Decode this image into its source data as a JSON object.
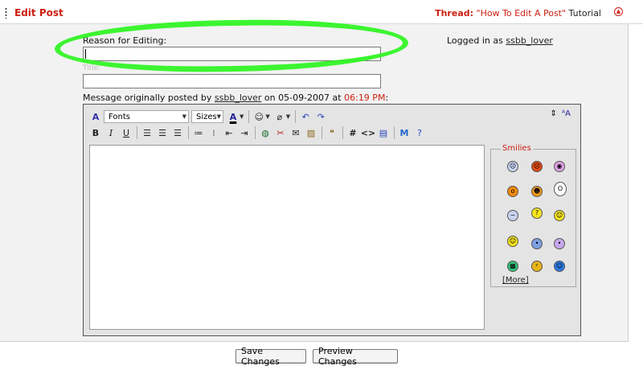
{
  "header": {
    "title": "Edit Post",
    "thread_prefix": "Thread:",
    "thread_title": "\"How To Edit A Post\"",
    "thread_suffix": "Tutorial"
  },
  "form": {
    "reason_label": "Reason for Editing:",
    "reason_value": "",
    "title_label": "Title:",
    "title_value": "",
    "logged_in_text": "Logged in as",
    "username": "ssbb_lover"
  },
  "original": {
    "prefix": "Message originally posted by",
    "author": "ssbb_lover",
    "on": "on",
    "date": "05-09-2007",
    "at": "at",
    "time": "06:19 PM",
    "colon": ":"
  },
  "toolbar": {
    "font_select": "Fonts",
    "size_select": "Sizes",
    "bold": "B",
    "italic": "I",
    "underline": "U",
    "hash": "#",
    "code": "<>"
  },
  "smilies": {
    "legend": "Smilies",
    "more_label": "[More]",
    "items": [
      "frown-blue",
      "mad",
      "purple",
      "eek",
      "cool",
      "shocked",
      "confused",
      "thinking",
      "smile",
      "smile2",
      "blue-eyes",
      "purple-eyes",
      "grin",
      "sleepy",
      "blue"
    ]
  },
  "buttons": {
    "save": "Save Changes",
    "preview": "Preview Changes"
  },
  "colors": {
    "accent_red": "#cc1f12",
    "highlight_green": "#28f51b"
  }
}
